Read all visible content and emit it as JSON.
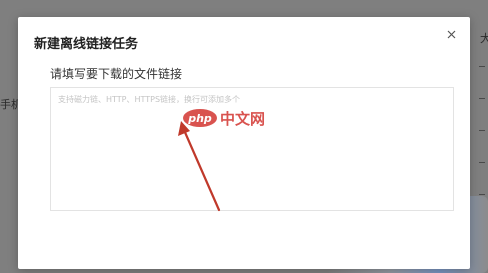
{
  "background": {
    "left_text": "手机备",
    "right_title": "大"
  },
  "dialog": {
    "title": "新建离线链接任务",
    "close_icon": "close-icon",
    "field_label": "请填写要下载的文件链接",
    "textarea": {
      "value": "",
      "placeholder": "支持磁力链、HTTP、HTTPS链接，换行可添加多个"
    }
  },
  "watermark": {
    "logo": "php-logo",
    "text": "中文网"
  },
  "colors": {
    "overlay": "#7f7f7f",
    "dialog_bg": "#ffffff",
    "arrow": "#c0392b",
    "watermark": "#d9534f"
  }
}
